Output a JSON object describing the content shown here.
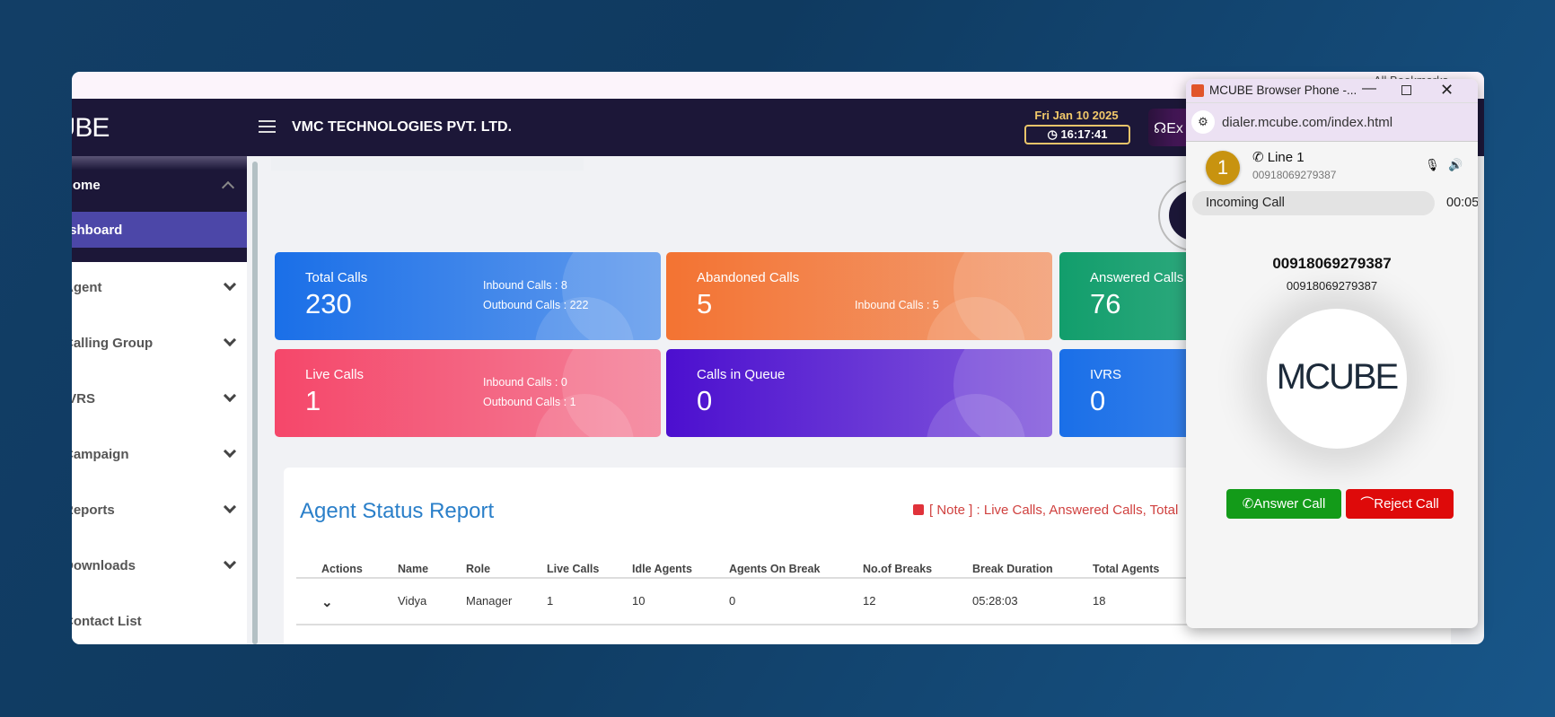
{
  "browser": {
    "bookmarks": "All Bookmarks"
  },
  "header": {
    "logo": "MCUBE",
    "company": "VMC TECHNOLOGIES PVT. LTD.",
    "date": "Fri Jan 10 2025",
    "time": "16:17:41",
    "ext_label": "Ex"
  },
  "sidebar": {
    "home": "Home",
    "dashboard": "Dashboard",
    "items": [
      "Agent",
      "Calling Group",
      "IVRS",
      "Campaign",
      "Reports",
      "Downloads",
      "Contact List"
    ]
  },
  "cards": [
    {
      "label": "Total Calls",
      "value": "230",
      "subs": [
        "Inbound Calls : 8",
        "Outbound Calls : 222"
      ],
      "color": "#1a6fe8"
    },
    {
      "label": "Abandoned Calls",
      "value": "5",
      "subs": [
        "Inbound Calls : 5"
      ],
      "color": "#f37332"
    },
    {
      "label": "Answered Calls",
      "value": "76",
      "subs": [],
      "color": "#129e6c"
    },
    {
      "label": "Live Calls",
      "value": "1",
      "subs": [
        "Inbound Calls : 0",
        "Outbound Calls : 1"
      ],
      "color": "#f5476a"
    },
    {
      "label": "Calls in Queue",
      "value": "0",
      "subs": [],
      "color": "#4c0fcf"
    },
    {
      "label": "IVRS",
      "value": "0",
      "subs": [],
      "color": "#1a6fe8"
    }
  ],
  "report": {
    "title": "Agent Status Report",
    "note": "[ Note ] : Live Calls, Answered Calls, Total",
    "columns": [
      "Actions",
      "Name",
      "Role",
      "Live Calls",
      "Idle Agents",
      "Agents On Break",
      "No.of Breaks",
      "Break Duration",
      "Total Agents"
    ],
    "rows": [
      [
        "⌄",
        "Vidya",
        "Manager",
        "1",
        "10",
        "0",
        "12",
        "05:28:03",
        "18"
      ]
    ]
  },
  "phone": {
    "window_title": "MCUBE Browser Phone -...",
    "url": "dialer.mcube.com/index.html",
    "line_number": "1",
    "line_label": "Line 1",
    "line_caller": "00918069279387",
    "status": "Incoming Call",
    "timer": "00:05",
    "caller_number": "00918069279387",
    "caller_sub": "00918069279387",
    "logo": "MCUBE",
    "answer": "Answer Call",
    "reject": "Reject Call"
  }
}
